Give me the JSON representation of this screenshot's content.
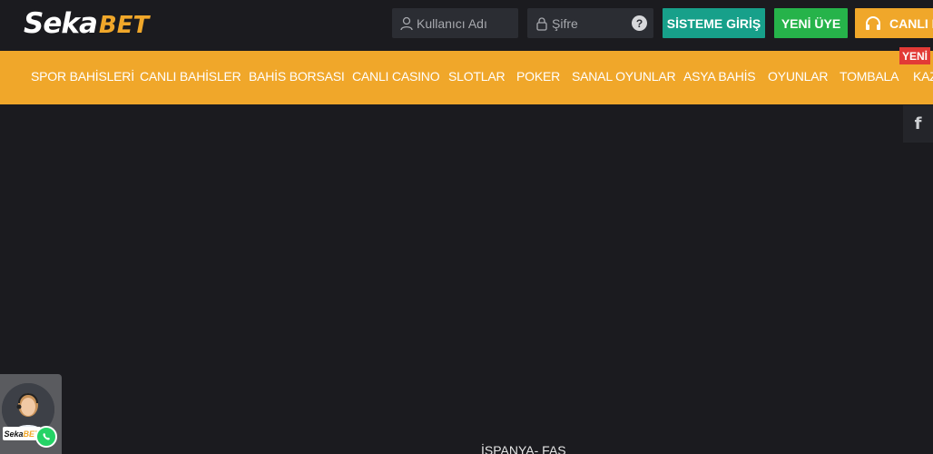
{
  "header": {
    "logo": {
      "part1": "Seka",
      "part2": "BET"
    },
    "username_placeholder": "Kullanıcı Adı",
    "password_placeholder": "Şifre",
    "help_icon": "question-circle",
    "login_label": "SİSTEME GİRİŞ",
    "register_label": "YENİ ÜYE",
    "live_support_label": "CANLI D"
  },
  "nav": {
    "items": [
      "SPOR BAHİSLERİ",
      "CANLI BAHİSLER",
      "BAHİS BORSASI",
      "CANLI CASINO",
      "SLOTLAR",
      "POKER",
      "SANAL OYUNLAR",
      "ASYA BAHİS",
      "OYUNLAR",
      "TOMBALA",
      "KAZ"
    ],
    "new_badge": "YENİ"
  },
  "social": {
    "facebook": "f"
  },
  "widget": {
    "logo_part1": "Seka",
    "logo_part2": "BET",
    "whatsapp_icon": "whatsapp"
  },
  "content": {
    "match_title": "İSPANYA- FAS"
  },
  "colors": {
    "background": "#1b1b1f",
    "accent": "#f0a72a",
    "login": "#17a08a",
    "register": "#26b34a",
    "badge": "#e23a36"
  }
}
